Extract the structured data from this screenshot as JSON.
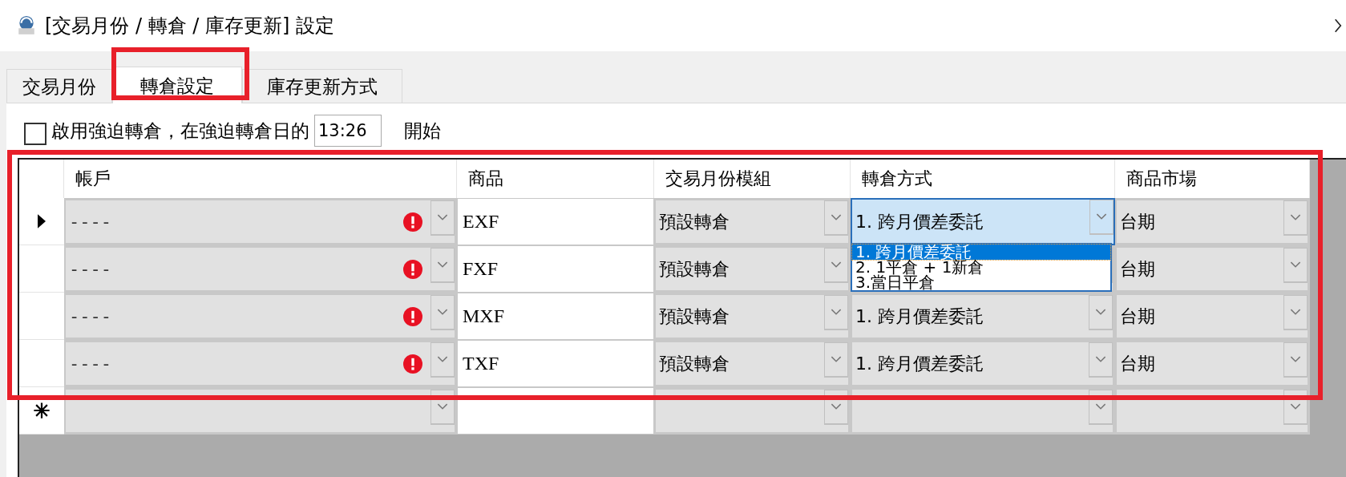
{
  "window": {
    "title": "[交易月份 / 轉倉 / 庫存更新] 設定"
  },
  "tabs": [
    {
      "label": "交易月份",
      "selected": false
    },
    {
      "label": "轉倉設定",
      "selected": true
    },
    {
      "label": "庫存更新方式",
      "selected": false
    }
  ],
  "force_rollover": {
    "checked": false,
    "label": "啟用強迫轉倉，在強迫轉倉日的",
    "time": "13:26",
    "suffix": "開始"
  },
  "grid": {
    "columns": [
      "帳戶",
      "商品",
      "交易月份模組",
      "轉倉方式",
      "商品市場"
    ],
    "rows": [
      {
        "current": true,
        "account": "----",
        "error": true,
        "product": "EXF",
        "module": "預設轉倉",
        "method": "1. 跨月價差委託",
        "market": "台期",
        "dropdown": [
          {
            "label": "1. 跨月價差委託",
            "selected": true
          },
          {
            "label": "2. 1平倉 + 1新倉",
            "selected": false
          },
          {
            "label": "3.當日平倉",
            "selected": false
          }
        ]
      },
      {
        "current": false,
        "account": "----",
        "error": true,
        "product": "FXF",
        "module": "預設轉倉",
        "market": "台期"
      },
      {
        "current": false,
        "account": "----",
        "error": true,
        "product": "MXF",
        "module": "預設轉倉",
        "method": "1. 跨月價差委託",
        "market": "台期"
      },
      {
        "current": false,
        "account": "----",
        "error": true,
        "product": "TXF",
        "module": "預設轉倉",
        "method": "1. 跨月價差委託",
        "market": "台期"
      }
    ]
  }
}
